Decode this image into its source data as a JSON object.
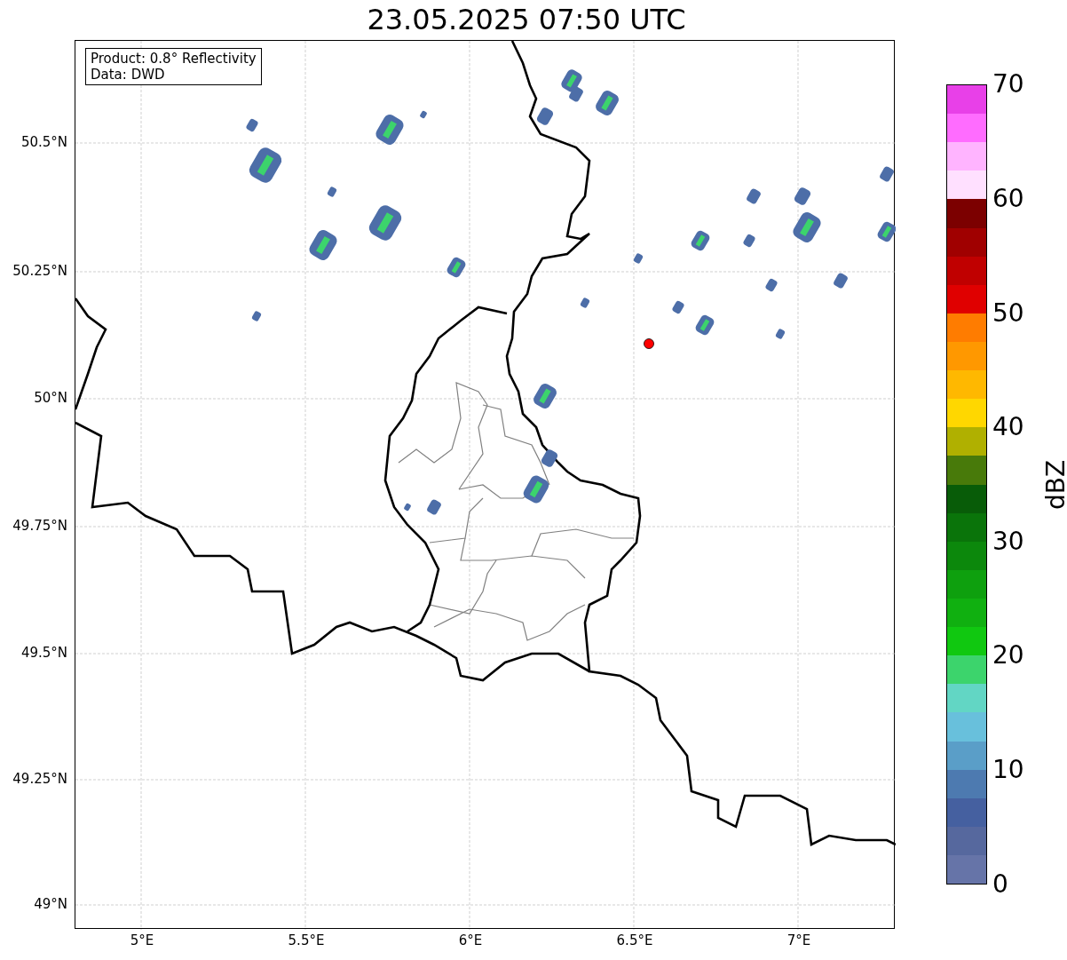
{
  "title": "23.05.2025 07:50 UTC",
  "info_box": {
    "lines": [
      "Product: 0.8° Reflectivity",
      "Data: DWD"
    ]
  },
  "x_ticks": [
    "5°E",
    "5.5°E",
    "6°E",
    "6.5°E",
    "7°E"
  ],
  "y_ticks": [
    "50.5°N",
    "50.25°N",
    "50°N",
    "49.75°N",
    "49.5°N",
    "49.25°N",
    "49°N"
  ],
  "colorbar": {
    "label": "dBZ",
    "ticks": [
      "70",
      "60",
      "50",
      "40",
      "30",
      "20",
      "10",
      "0"
    ],
    "bins": [
      {
        "color": "#e840e8"
      },
      {
        "color": "#ff6cff"
      },
      {
        "color": "#ffb4ff"
      },
      {
        "color": "#ffe0ff"
      },
      {
        "color": "#7c0000"
      },
      {
        "color": "#a00000"
      },
      {
        "color": "#c00000"
      },
      {
        "color": "#e00000"
      },
      {
        "color": "#ff7c00"
      },
      {
        "color": "#ff9800"
      },
      {
        "color": "#ffb800"
      },
      {
        "color": "#ffd700"
      },
      {
        "color": "#b0b000"
      },
      {
        "color": "#487a0a"
      },
      {
        "color": "#085c08"
      },
      {
        "color": "#0a740a"
      },
      {
        "color": "#0c880c"
      },
      {
        "color": "#0ea00e"
      },
      {
        "color": "#10b010"
      },
      {
        "color": "#10c810"
      },
      {
        "color": "#3cd46c"
      },
      {
        "color": "#62d6c4"
      },
      {
        "color": "#68c0dc"
      },
      {
        "color": "#5a9ec8"
      },
      {
        "color": "#4d7ab0"
      },
      {
        "color": "#4560a0"
      },
      {
        "color": "#56689e"
      },
      {
        "color": "#6674a8"
      }
    ]
  }
}
